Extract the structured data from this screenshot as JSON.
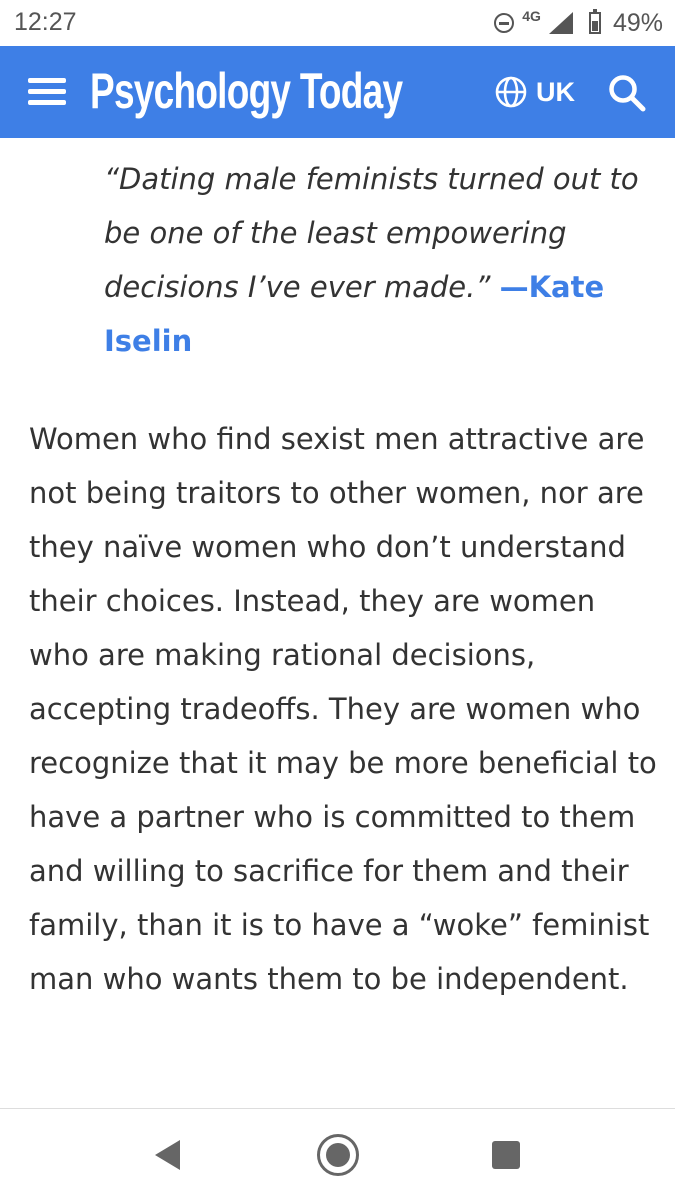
{
  "status_bar": {
    "time": "12:27",
    "network": "4G",
    "battery": "49%",
    "icons": [
      "do-not-disturb-icon",
      "signal-icon",
      "battery-icon"
    ]
  },
  "header": {
    "brand": "Psychology Today",
    "region": "UK",
    "background_color": "#3e7fe6",
    "icons": [
      "menu-icon",
      "globe-icon",
      "search-icon"
    ]
  },
  "article": {
    "quote": {
      "text": "“Dating male feminists turned out to be one of the least empowering decisions I’ve ever made.” ",
      "author": "—Kate Iselin"
    },
    "paragraph": "Women who find sexist men attractive are not being traitors to other women, nor are they naïve women who don’t understand their choices. Instead, they are women who are making rational decisions, accepting tradeoffs. They are women who recognize that it may be more beneficial to have a partner who is committed to them and willing to sacrifice for them and their family, than it is to have a “woke” feminist man who wants them to be independent."
  },
  "nav_bar": {
    "icons": [
      "back-icon",
      "home-icon",
      "recent-apps-icon"
    ]
  }
}
